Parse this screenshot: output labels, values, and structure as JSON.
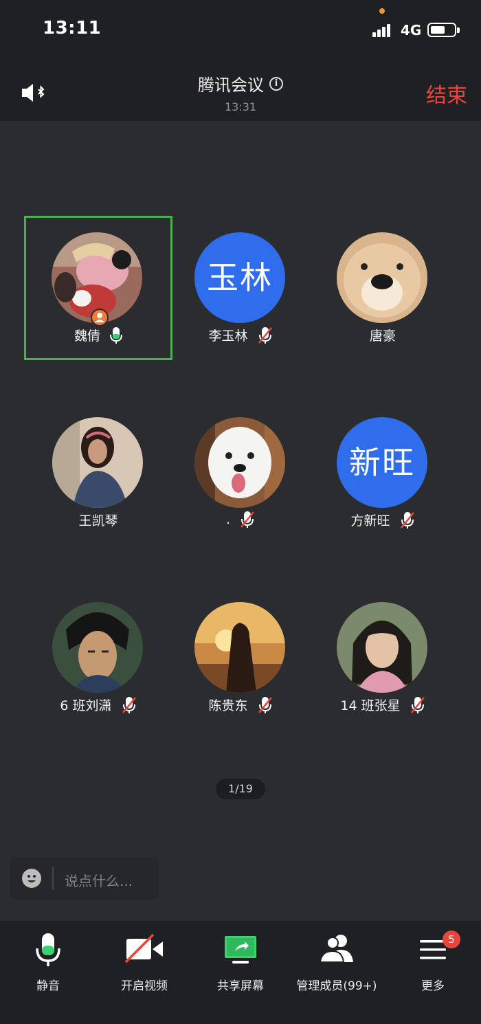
{
  "status_bar": {
    "time": "13:11",
    "network": "4G"
  },
  "header": {
    "title": "腾讯会议",
    "timer": "13:31",
    "end_label": "结束"
  },
  "participants": [
    {
      "name": "魏倩",
      "avatar_text": "",
      "mic": "on",
      "active": true,
      "avatar_desc": "mickey-mouse-photo"
    },
    {
      "name": "李玉林",
      "avatar_text": "玉林",
      "mic": "muted"
    },
    {
      "name": "唐豪",
      "avatar_text": "",
      "mic": "none",
      "avatar_desc": "shiba-dog-photo"
    },
    {
      "name": "王凯琴",
      "avatar_text": "",
      "mic": "none",
      "avatar_desc": "woman-photo"
    },
    {
      "name": ".",
      "avatar_text": "",
      "mic": "muted",
      "avatar_desc": "samoyed-dog-photo"
    },
    {
      "name": "方新旺",
      "avatar_text": "新旺",
      "mic": "muted"
    },
    {
      "name": "6 班刘潇",
      "avatar_text": "",
      "mic": "muted",
      "avatar_desc": "anime-man-photo"
    },
    {
      "name": "陈贵东",
      "avatar_text": "",
      "mic": "muted",
      "avatar_desc": "sunset-silhouette-photo"
    },
    {
      "name": "14 班张星",
      "avatar_text": "",
      "mic": "muted",
      "avatar_desc": "girl-photo"
    }
  ],
  "page_indicator": "1/19",
  "chat": {
    "placeholder": "说点什么..."
  },
  "toolbar": {
    "mute_label": "静音",
    "video_label": "开启视频",
    "share_label": "共享屏幕",
    "members_label": "管理成员(99+)",
    "more_label": "更多",
    "more_badge": "5"
  },
  "colors": {
    "accent_red": "#e8453c",
    "active_green": "#4cb050",
    "avatar_blue": "#2f6ded",
    "mic_green": "#3bd16f"
  }
}
